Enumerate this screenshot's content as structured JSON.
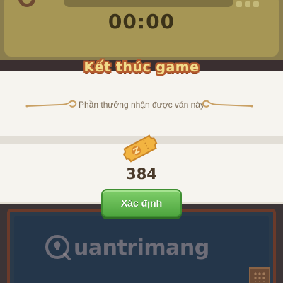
{
  "background": {
    "timer": "00:00"
  },
  "dialog": {
    "title": "Kết thúc game",
    "subtitle": "Phần thưởng nhận được ván này",
    "reward_icon": "ticket-icon",
    "reward_amount": "384",
    "confirm_label": "Xác định"
  },
  "watermark": {
    "text": "uantrimang",
    "icon": "lightbulb-q-icon"
  },
  "colors": {
    "confirm_green": "#5bb449",
    "title_fill": "#f2dc8a",
    "title_outline": "#b35a2e",
    "ticket_gold": "#f2b441"
  }
}
